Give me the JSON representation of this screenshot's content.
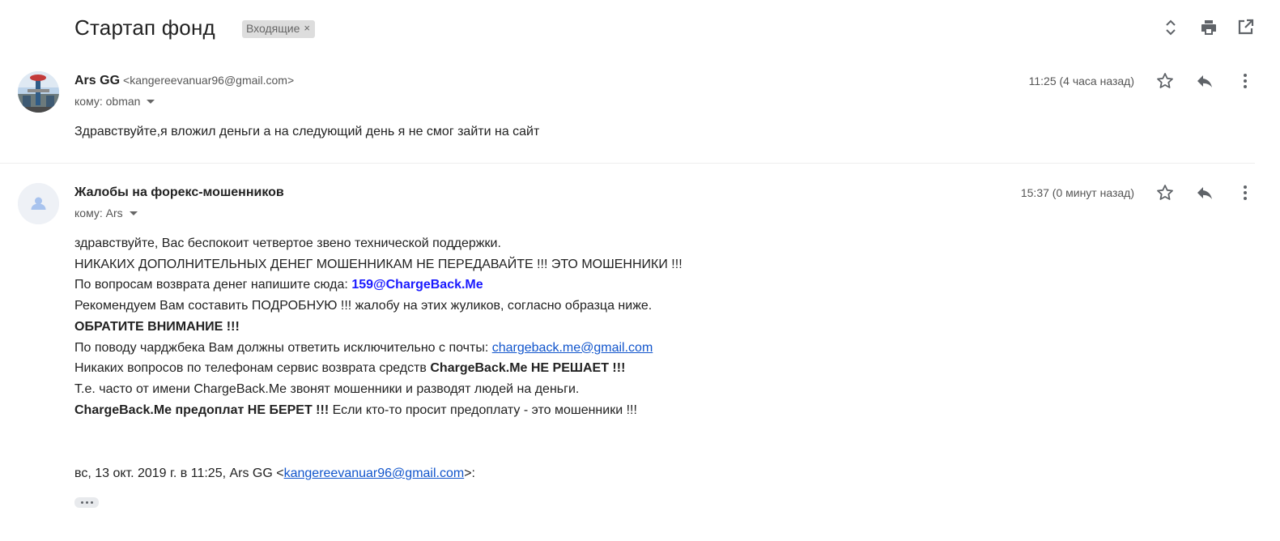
{
  "thread": {
    "subject": "Стартап фонд",
    "label": "Входящие",
    "label_close": "×"
  },
  "toolbar": {
    "icons": [
      "expand-collapse-icon",
      "print-icon",
      "open-in-new-window-icon"
    ]
  },
  "messages": [
    {
      "sender_name": "Ars GG",
      "sender_email": "<kangereevanuar96@gmail.com>",
      "to": "кому: obman",
      "time": "11:25 (4 часа назад)",
      "body": "Здравствуйте,я вложил деньги а на следующий день я не смог зайти на сайт"
    },
    {
      "sender_name": "Жалобы на форекс-мошенников",
      "sender_email": "",
      "to": "кому: Ars",
      "time": "15:37 (0 минут назад)",
      "lines": {
        "l1": "здравствуйте, Вас беспокоит четвертое звено технической поддержки.",
        "l2": "НИКАКИХ ДОПОЛНИТЕЛЬНЫХ ДЕНЕГ МОШЕННИКАМ НЕ ПЕРЕДАВАЙТЕ !!! ЭТО МОШЕННИКИ !!!",
        "l3_prefix": "По вопросам возврата денег напишите сюда: ",
        "l3_email": "159@ChargeBack.Me",
        "l4": "Рекомендуем Вам составить ПОДРОБНУЮ !!! жалобу на этих жуликов, согласно образца ниже.",
        "l5": "ОБРАТИТЕ ВНИМАНИЕ !!!",
        "l6_prefix": "По поводу чарджбека Вам должны ответить исключительно с почты: ",
        "l6_link": "chargeback.me@gmail.com",
        "l7_prefix": "Никаких вопросов по телефонам сервис возврата средств ",
        "l7_bold": "ChargeBack.Me НЕ РЕШАЕТ !!!",
        "l8": "Т.е. часто от имени ChargeBack.Me звонят мошенники и разводят людей на деньги.",
        "l9_bold": "ChargeBack.Me предоплат НЕ БЕРЕТ !!!",
        "l9_rest": " Если кто-то просит предоплату - это мошенники !!!"
      },
      "quote": {
        "prefix": "вс, 13 окт. 2019 г. в 11:25, Ars GG <",
        "link": "kangereevanuar96@gmail.com",
        "suffix": ">:"
      }
    }
  ],
  "colors": {
    "link": "#1155cc",
    "bold_link": "#1a1aff",
    "icon": "#5f6368",
    "label_bg": "#dddddd"
  }
}
